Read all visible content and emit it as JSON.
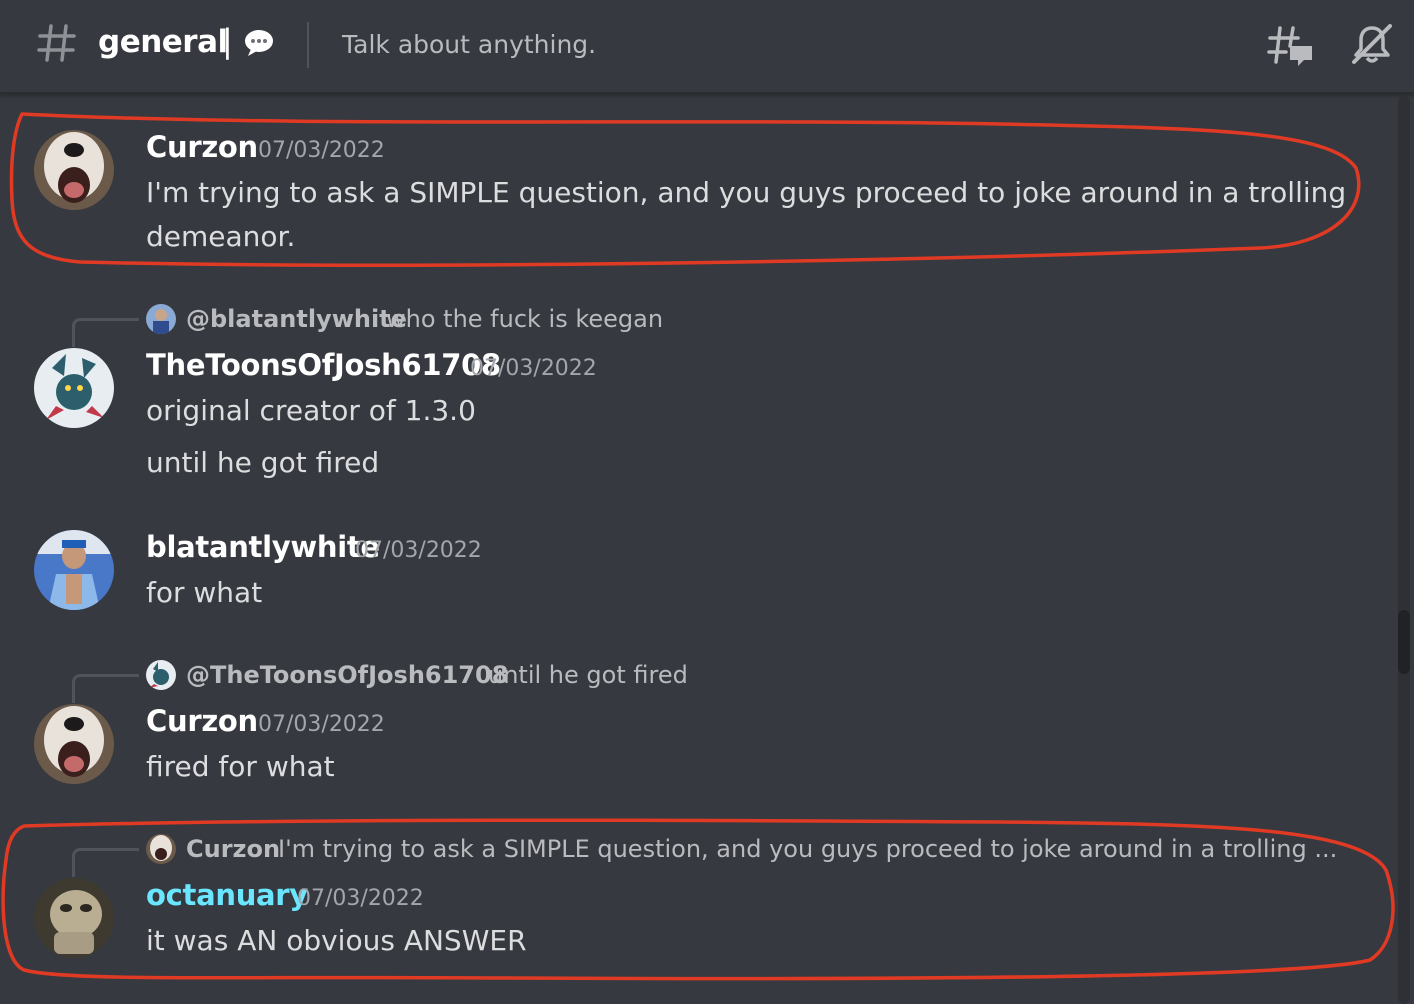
{
  "header": {
    "channel_name": "general",
    "separator": "|",
    "topic": "Talk about anything.",
    "icons": [
      "hash-icon",
      "speech-bubble-emoji-icon",
      "threads-icon",
      "mute-bell-icon"
    ]
  },
  "messages": [
    {
      "username": "Curzon",
      "timestamp": "07/03/2022",
      "lines": [
        "I'm trying to ask a SIMPLE question, and you guys proceed to joke around in a trolling",
        "demeanor."
      ]
    },
    {
      "reply": {
        "user": "@blatantlywhite",
        "text": "who the fuck is keegan"
      },
      "username": "TheToonsOfJosh61708",
      "timestamp": "07/03/2022",
      "lines": [
        "original creator of 1.3.0",
        "until he got fired"
      ]
    },
    {
      "username": "blatantlywhite",
      "timestamp": "07/03/2022",
      "lines": [
        "for what"
      ]
    },
    {
      "reply": {
        "user": "@TheToonsOfJosh61708",
        "text": "until he got fired"
      },
      "username": "Curzon",
      "timestamp": "07/03/2022",
      "lines": [
        "fired for what"
      ]
    },
    {
      "reply": {
        "user": "Curzon",
        "text": "I'm trying to ask a SIMPLE question, and you guys proceed to joke around in a trolling ..."
      },
      "username": "octanuary",
      "username_color": "#6ae6ff",
      "timestamp": "07/03/2022",
      "lines": [
        "it was AN obvious ANSWER"
      ]
    }
  ],
  "colors": {
    "background": "#36393f",
    "annotation": "#e03a24",
    "octanuary_name": "#6ae6ff"
  }
}
